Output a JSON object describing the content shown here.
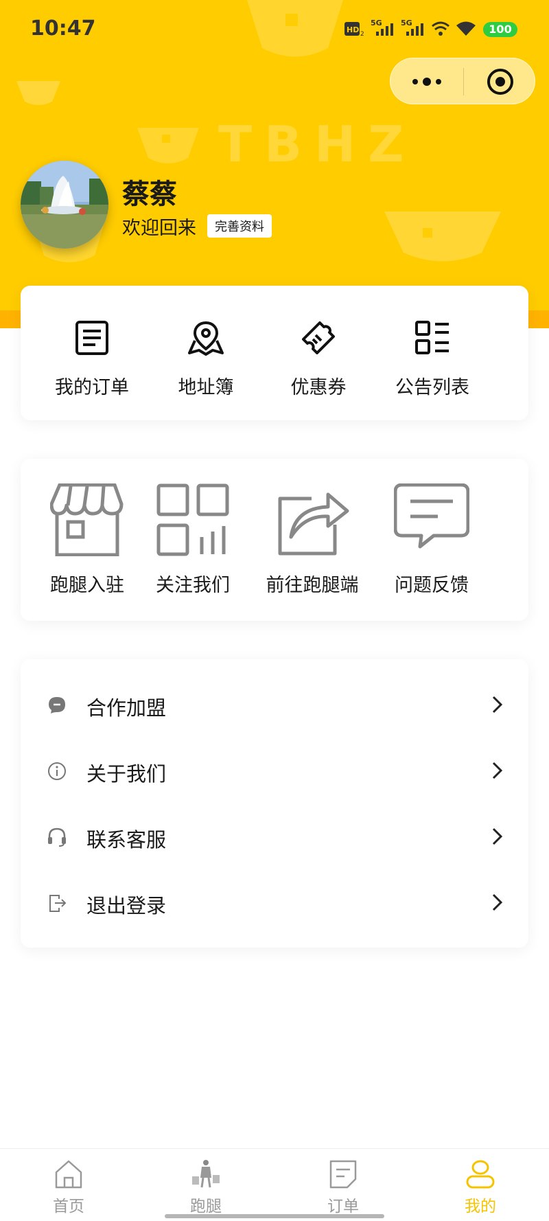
{
  "status_bar": {
    "time": "10:47",
    "battery": "100",
    "network": [
      "HD",
      "5G",
      "5G"
    ]
  },
  "watermark": "TBHZ",
  "profile": {
    "username": "蔡蔡",
    "welcome": "欢迎回来",
    "edit_label": "完善资料"
  },
  "quick_menu": [
    {
      "label": "我的订单",
      "icon": "order-list-icon"
    },
    {
      "label": "地址簿",
      "icon": "map-pin-icon"
    },
    {
      "label": "优惠券",
      "icon": "coupon-ticket-icon"
    },
    {
      "label": "公告列表",
      "icon": "bulletin-list-icon"
    }
  ],
  "service_menu": [
    {
      "label": "跑腿入驻",
      "icon": "storefront-icon"
    },
    {
      "label": "关注我们",
      "icon": "qr-code-icon"
    },
    {
      "label": "前往跑腿端",
      "icon": "share-forward-icon"
    },
    {
      "label": "问题反馈",
      "icon": "message-bubble-icon"
    }
  ],
  "settings_list": [
    {
      "label": "合作加盟",
      "icon": "chat-bubble-icon"
    },
    {
      "label": "关于我们",
      "icon": "info-icon"
    },
    {
      "label": "联系客服",
      "icon": "headset-icon"
    },
    {
      "label": "退出登录",
      "icon": "logout-icon"
    }
  ],
  "tabbar": [
    {
      "label": "首页",
      "icon": "home-icon",
      "active": false
    },
    {
      "label": "跑腿",
      "icon": "courier-icon",
      "active": false
    },
    {
      "label": "订单",
      "icon": "order-icon",
      "active": false
    },
    {
      "label": "我的",
      "icon": "user-icon",
      "active": true
    }
  ],
  "colors": {
    "brand": "#FFCC00",
    "accent_strip": "#FFB300",
    "tab_active": "#F5C400",
    "tab_inactive": "#9a9a9a",
    "battery": "#2ecc40"
  }
}
